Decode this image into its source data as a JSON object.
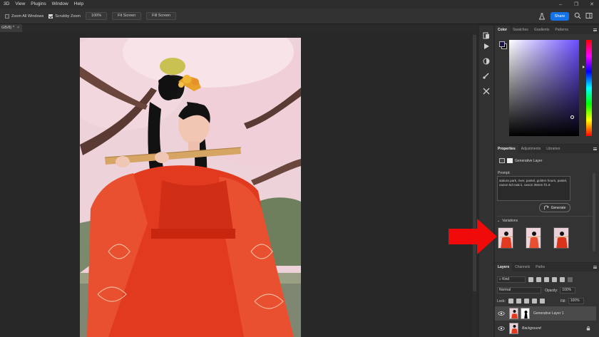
{
  "menu": [
    "3D",
    "View",
    "Plugins",
    "Window",
    "Help"
  ],
  "options_bar": {
    "zoom_all_windows": "Zoom All Windows",
    "scrubby_zoom": "Scrubby Zoom",
    "zoom_percent": "100%",
    "fit_screen": "Fit Screen",
    "fill_screen": "Fill Screen",
    "share": "Share"
  },
  "document_tab": {
    "label": "GB/8) *",
    "close": "×"
  },
  "color_panel": {
    "tabs": [
      "Color",
      "Swatches",
      "Gradients",
      "Patterns"
    ],
    "foreground": "#17124a",
    "background": "#000000"
  },
  "properties_panel": {
    "tabs": [
      "Properties",
      "Adjustments",
      "Libraries"
    ],
    "layer_type": "Generative Layer",
    "prompt_label": "Prompt:",
    "prompt_text": "sakura park, river, pastel, golden hours, pastel, canon 5d mak ii, canon 35mm f/1.8",
    "generate_label": "Generate",
    "variations_label": "Variations"
  },
  "layers_panel": {
    "tabs": [
      "Layers",
      "Channels",
      "Paths"
    ],
    "kind": "Kind",
    "blend_mode": "Normal",
    "opacity_label": "Opacity:",
    "opacity_value": "100%",
    "lock_label": "Lock:",
    "fill_label": "Fill:",
    "fill_value": "100%",
    "layers": [
      {
        "name": "Generative Layer 1",
        "selected": true
      },
      {
        "name": "Background",
        "selected": false,
        "locked": true
      }
    ]
  }
}
